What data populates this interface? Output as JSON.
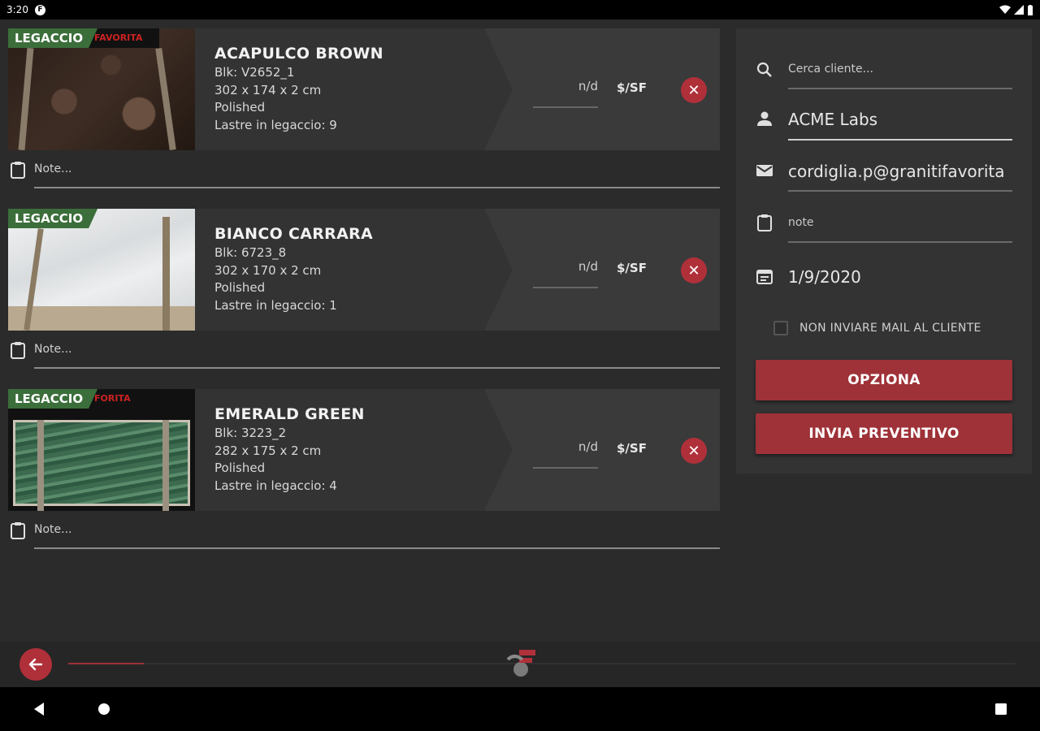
{
  "status_bar": {
    "time": "3:20"
  },
  "products": [
    {
      "badge": "LEGACCIO",
      "brand_strip": "FAVORITA",
      "name": "ACAPULCO BROWN",
      "block": "Blk: V2652_1",
      "size": "302 x 174 x 2 cm",
      "finish": "Polished",
      "slabs": "Lastre in legaccio: 9",
      "price": "n/d",
      "unit": "$/SF",
      "note_placeholder": "Note...",
      "stone_color": "#3a2a22"
    },
    {
      "badge": "LEGACCIO",
      "brand_strip": "",
      "name": "BIANCO CARRARA",
      "block": "Blk: 6723_8",
      "size": "302 x 170 x 2 cm",
      "finish": "Polished",
      "slabs": "Lastre in legaccio: 1",
      "price": "n/d",
      "unit": "$/SF",
      "note_placeholder": "Note...",
      "stone_color": "#dfe2e4"
    },
    {
      "badge": "LEGACCIO",
      "brand_strip": "FORITA",
      "name": "EMERALD GREEN",
      "block": "Blk: 3223_2",
      "size": "282 x 175 x 2 cm",
      "finish": "Polished",
      "slabs": "Lastre in legaccio: 4",
      "price": "n/d",
      "unit": "$/SF",
      "note_placeholder": "Note...",
      "stone_color": "#4c7a5c"
    }
  ],
  "panel": {
    "search_placeholder": "Cerca cliente...",
    "client_name": "ACME Labs",
    "email": "cordiglia.p@granitifavorita",
    "note_placeholder": "note",
    "date": "1/9/2020",
    "no_mail_label": "NON INVIARE MAIL AL CLIENTE",
    "no_mail_checked": false,
    "option_button": "OPZIONA",
    "quote_button": "INVIA PREVENTIVO"
  },
  "progress": {
    "fraction": 0.08
  },
  "colors": {
    "accent": "#9e3238",
    "badge_green": "#3b6e3a",
    "panel": "#333333",
    "background": "#2b2b2b"
  }
}
